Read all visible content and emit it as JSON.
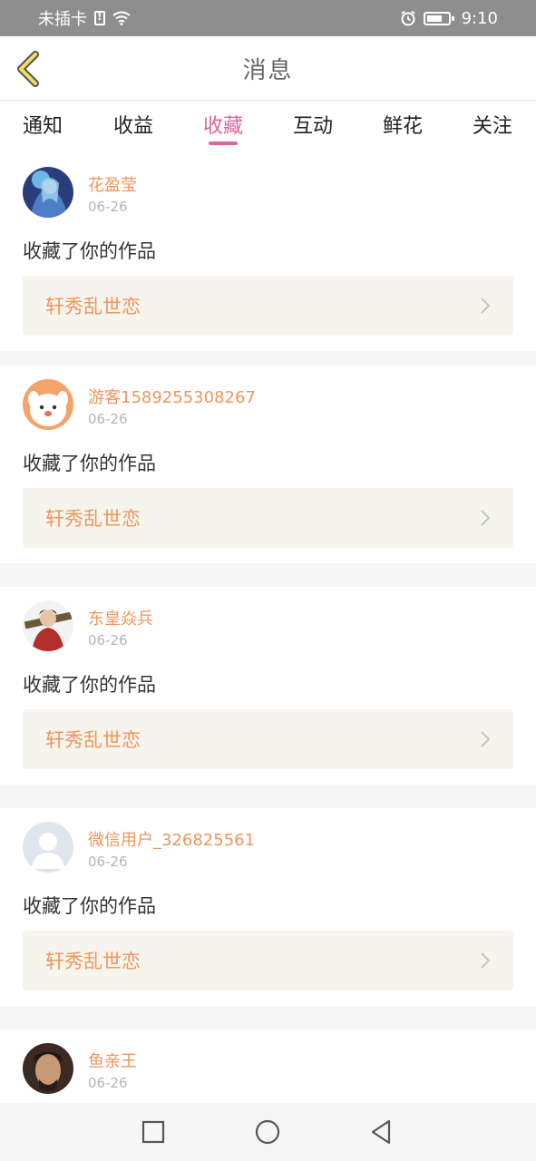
{
  "status_bar": {
    "carrier": "未插卡",
    "time": "9:10"
  },
  "header": {
    "title": "消息"
  },
  "tabs": [
    {
      "label": "通知",
      "active": false
    },
    {
      "label": "收益",
      "active": false
    },
    {
      "label": "收藏",
      "active": true
    },
    {
      "label": "互动",
      "active": false
    },
    {
      "label": "鲜花",
      "active": false
    },
    {
      "label": "关注",
      "active": false
    }
  ],
  "items": [
    {
      "username": "花盈莹",
      "date": "06-26",
      "message": "收藏了你的作品",
      "work_title": "轩秀乱世恋"
    },
    {
      "username": "游客1589255308267",
      "date": "06-26",
      "message": "收藏了你的作品",
      "work_title": "轩秀乱世恋"
    },
    {
      "username": "东皇焱兵",
      "date": "06-26",
      "message": "收藏了你的作品",
      "work_title": "轩秀乱世恋"
    },
    {
      "username": "微信用户_326825561",
      "date": "06-26",
      "message": "收藏了你的作品",
      "work_title": "轩秀乱世恋"
    },
    {
      "username": "鱼亲王",
      "date": "06-26",
      "message": "",
      "work_title": ""
    }
  ],
  "colors": {
    "accent": "#e0659a",
    "name": "#f0955b",
    "back": "#e8c93a"
  }
}
